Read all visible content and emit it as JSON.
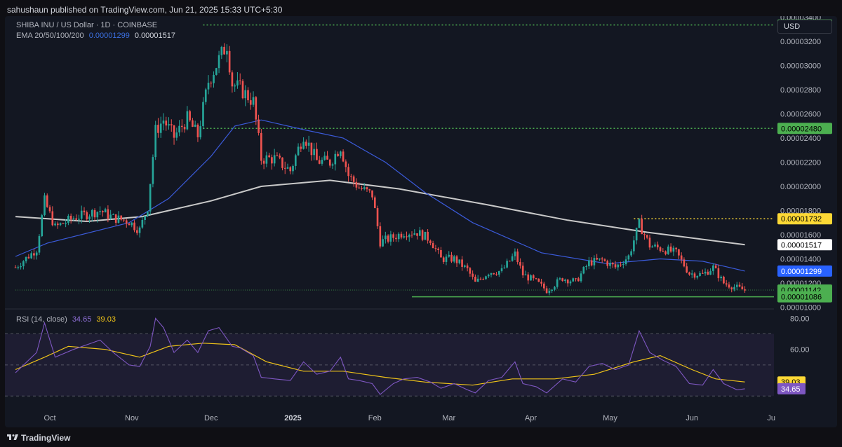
{
  "attribution": "sahushaun published on TradingView.com, Jun 21, 2025 15:33 UTC+5:30",
  "symbol_line": "SHIBA INU / US Dollar · 1D · COINBASE",
  "ema_legend": {
    "label": "EMA 20/50/100/200",
    "value1": "0.00001299",
    "value2": "0.00001517"
  },
  "rsi_legend": {
    "label": "RSI (14, close)",
    "value1": "34.65",
    "value2": "39.03"
  },
  "currency_button": "USD",
  "footer_brand": "TradingView",
  "colors": {
    "up": "#26a69a",
    "down": "#ef5350",
    "ema50": "#3b5bdb",
    "ema200": "#c9c9c9",
    "rsi": "#7e57c2",
    "rsi_ma": "#f0c419",
    "green_level": "#4caf50",
    "yellow_level": "#fdd835"
  },
  "chart_data": [
    {
      "type": "candlestick",
      "title": "SHIBA INU / US Dollar · 1D · COINBASE",
      "x_ticks": [
        "Oct",
        "Nov",
        "Dec",
        "2025",
        "Feb",
        "Mar",
        "Apr",
        "May",
        "Jun",
        "Ju"
      ],
      "y_ticks": [
        "0.00003400",
        "0.00003200",
        "0.00003000",
        "0.00002800",
        "0.00002600",
        "0.00002400",
        "0.00002200",
        "0.00002000",
        "0.00001800",
        "0.00001600",
        "0.00001400",
        "0.00001200",
        "0.00001000"
      ],
      "ylim": [
        9.85e-06,
        3.41e-05
      ],
      "price_labels": [
        {
          "text": "0.00003337",
          "value": 3.337e-05,
          "kind": "green"
        },
        {
          "text": "0.00002480",
          "value": 2.48e-05,
          "kind": "green"
        },
        {
          "text": "0.00001732",
          "value": 1.732e-05,
          "kind": "yellow"
        },
        {
          "text": "0.00001517",
          "value": 1.517e-05,
          "kind": "white"
        },
        {
          "text": "0.00001299",
          "value": 1.299e-05,
          "kind": "blue"
        },
        {
          "text": "0.00001142",
          "value": 1.142e-05,
          "kind": "green"
        },
        {
          "text": "0.00001086",
          "value": 1.086e-05,
          "kind": "green"
        }
      ],
      "levels": [
        {
          "value": 3.337e-05,
          "from": "2024-11-28",
          "style": "dotted-green"
        },
        {
          "value": 2.48e-05,
          "from": "2024-11-28",
          "style": "dotted-green"
        },
        {
          "value": 1.732e-05,
          "from": "2025-05-10",
          "style": "dotted-yellow"
        },
        {
          "value": 1.142e-05,
          "from": "2024-09-18",
          "style": "dotted-green-thin"
        },
        {
          "value": 1.086e-05,
          "from": "2025-02-15",
          "style": "solid-green"
        }
      ],
      "close_path": [
        [
          "2024-09-18",
          1.33e-05
        ],
        [
          "2024-09-26",
          1.48e-05
        ],
        [
          "2024-09-29",
          1.88e-05
        ],
        [
          "2024-10-03",
          1.66e-05
        ],
        [
          "2024-10-10",
          1.74e-05
        ],
        [
          "2024-10-20",
          1.8e-05
        ],
        [
          "2024-10-25",
          1.74e-05
        ],
        [
          "2024-10-31",
          1.71e-05
        ],
        [
          "2024-11-02",
          1.67e-05
        ],
        [
          "2024-11-04",
          1.64e-05
        ],
        [
          "2024-11-07",
          1.83e-05
        ],
        [
          "2024-11-10",
          2.46e-05
        ],
        [
          "2024-11-13",
          2.55e-05
        ],
        [
          "2024-11-17",
          2.41e-05
        ],
        [
          "2024-11-22",
          2.56e-05
        ],
        [
          "2024-11-26",
          2.42e-05
        ],
        [
          "2024-11-30",
          2.87e-05
        ],
        [
          "2024-12-04",
          3.05e-05
        ],
        [
          "2024-12-07",
          3.18e-05
        ],
        [
          "2024-12-09",
          2.85e-05
        ],
        [
          "2024-12-12",
          2.81e-05
        ],
        [
          "2024-12-17",
          2.7e-05
        ],
        [
          "2024-12-20",
          2.23e-05
        ],
        [
          "2024-12-25",
          2.23e-05
        ],
        [
          "2024-12-31",
          2.13e-05
        ],
        [
          "2025-01-05",
          2.43e-05
        ],
        [
          "2025-01-10",
          2.21e-05
        ],
        [
          "2025-01-15",
          2.2e-05
        ],
        [
          "2025-01-19",
          2.33e-05
        ],
        [
          "2025-01-22",
          2.09e-05
        ],
        [
          "2025-01-26",
          1.99e-05
        ],
        [
          "2025-01-31",
          1.93e-05
        ],
        [
          "2025-02-03",
          1.54e-05
        ],
        [
          "2025-02-08",
          1.58e-05
        ],
        [
          "2025-02-12",
          1.62e-05
        ],
        [
          "2025-02-17",
          1.62e-05
        ],
        [
          "2025-02-22",
          1.56e-05
        ],
        [
          "2025-02-26",
          1.4e-05
        ],
        [
          "2025-03-03",
          1.4e-05
        ],
        [
          "2025-03-08",
          1.31e-05
        ],
        [
          "2025-03-11",
          1.2e-05
        ],
        [
          "2025-03-16",
          1.29e-05
        ],
        [
          "2025-03-21",
          1.3e-05
        ],
        [
          "2025-03-26",
          1.44e-05
        ],
        [
          "2025-03-29",
          1.27e-05
        ],
        [
          "2025-04-03",
          1.21e-05
        ],
        [
          "2025-04-07",
          1.14e-05
        ],
        [
          "2025-04-13",
          1.24e-05
        ],
        [
          "2025-04-18",
          1.21e-05
        ],
        [
          "2025-04-23",
          1.37e-05
        ],
        [
          "2025-04-28",
          1.39e-05
        ],
        [
          "2025-05-03",
          1.33e-05
        ],
        [
          "2025-05-08",
          1.42e-05
        ],
        [
          "2025-05-12",
          1.69e-05
        ],
        [
          "2025-05-16",
          1.51e-05
        ],
        [
          "2025-05-21",
          1.48e-05
        ],
        [
          "2025-05-26",
          1.45e-05
        ],
        [
          "2025-05-31",
          1.28e-05
        ],
        [
          "2025-06-05",
          1.27e-05
        ],
        [
          "2025-06-09",
          1.33e-05
        ],
        [
          "2025-06-13",
          1.2e-05
        ],
        [
          "2025-06-18",
          1.16e-05
        ],
        [
          "2025-06-21",
          1.14e-05
        ]
      ],
      "ema50": [
        [
          "2024-09-18",
          1.42e-05
        ],
        [
          "2024-09-30",
          1.53e-05
        ],
        [
          "2024-10-31",
          1.7e-05
        ],
        [
          "2024-11-15",
          1.9e-05
        ],
        [
          "2024-12-01",
          2.25e-05
        ],
        [
          "2024-12-10",
          2.5e-05
        ],
        [
          "2024-12-20",
          2.55e-05
        ],
        [
          "2025-01-05",
          2.47e-05
        ],
        [
          "2025-01-20",
          2.4e-05
        ],
        [
          "2025-02-05",
          2.2e-05
        ],
        [
          "2025-02-20",
          1.95e-05
        ],
        [
          "2025-03-10",
          1.7e-05
        ],
        [
          "2025-04-05",
          1.45e-05
        ],
        [
          "2025-04-30",
          1.36e-05
        ],
        [
          "2025-05-20",
          1.4e-05
        ],
        [
          "2025-06-05",
          1.38e-05
        ],
        [
          "2025-06-21",
          1.299e-05
        ]
      ],
      "ema200": [
        [
          "2024-09-18",
          1.75e-05
        ],
        [
          "2024-10-15",
          1.71e-05
        ],
        [
          "2024-11-05",
          1.75e-05
        ],
        [
          "2024-12-01",
          1.88e-05
        ],
        [
          "2024-12-20",
          2e-05
        ],
        [
          "2025-01-15",
          2.05e-05
        ],
        [
          "2025-02-10",
          1.98e-05
        ],
        [
          "2025-03-15",
          1.85e-05
        ],
        [
          "2025-04-15",
          1.72e-05
        ],
        [
          "2025-05-15",
          1.62e-05
        ],
        [
          "2025-06-21",
          1.517e-05
        ]
      ]
    },
    {
      "type": "line",
      "title": "RSI (14, close)",
      "y_ticks": [
        "80.00",
        "60.00"
      ],
      "ylim": [
        22,
        86
      ],
      "guides": [
        70,
        50,
        30
      ],
      "value_labels": [
        {
          "text": "39.03",
          "value": 39.03,
          "kind": "yellow"
        },
        {
          "text": "34.65",
          "value": 34.65,
          "kind": "purple"
        }
      ],
      "series": [
        {
          "name": "RSI",
          "values": [
            [
              "2024-09-18",
              45
            ],
            [
              "2024-09-26",
              58
            ],
            [
              "2024-09-29",
              77
            ],
            [
              "2024-10-03",
              55
            ],
            [
              "2024-10-10",
              60
            ],
            [
              "2024-10-20",
              66
            ],
            [
              "2024-10-25",
              58
            ],
            [
              "2024-10-31",
              50
            ],
            [
              "2024-11-04",
              49
            ],
            [
              "2024-11-08",
              62
            ],
            [
              "2024-11-10",
              80
            ],
            [
              "2024-11-13",
              74
            ],
            [
              "2024-11-17",
              58
            ],
            [
              "2024-11-22",
              66
            ],
            [
              "2024-11-26",
              58
            ],
            [
              "2024-11-30",
              72
            ],
            [
              "2024-12-04",
              74
            ],
            [
              "2024-12-09",
              62
            ],
            [
              "2024-12-12",
              61
            ],
            [
              "2024-12-17",
              56
            ],
            [
              "2024-12-20",
              42
            ],
            [
              "2024-12-25",
              41
            ],
            [
              "2024-12-31",
              40
            ],
            [
              "2025-01-05",
              52
            ],
            [
              "2025-01-10",
              44
            ],
            [
              "2025-01-15",
              46
            ],
            [
              "2025-01-19",
              55
            ],
            [
              "2025-01-22",
              41
            ],
            [
              "2025-01-26",
              40
            ],
            [
              "2025-01-31",
              38
            ],
            [
              "2025-02-03",
              31
            ],
            [
              "2025-02-08",
              38
            ],
            [
              "2025-02-12",
              41
            ],
            [
              "2025-02-17",
              42
            ],
            [
              "2025-02-22",
              39
            ],
            [
              "2025-02-26",
              35
            ],
            [
              "2025-03-03",
              38
            ],
            [
              "2025-03-08",
              34
            ],
            [
              "2025-03-11",
              32
            ],
            [
              "2025-03-16",
              40
            ],
            [
              "2025-03-21",
              42
            ],
            [
              "2025-03-26",
              52
            ],
            [
              "2025-03-29",
              38
            ],
            [
              "2025-04-03",
              36
            ],
            [
              "2025-04-07",
              32
            ],
            [
              "2025-04-13",
              41
            ],
            [
              "2025-04-18",
              39
            ],
            [
              "2025-04-23",
              49
            ],
            [
              "2025-04-28",
              51
            ],
            [
              "2025-05-03",
              47
            ],
            [
              "2025-05-08",
              50
            ],
            [
              "2025-05-12",
              72
            ],
            [
              "2025-05-16",
              58
            ],
            [
              "2025-05-21",
              53
            ],
            [
              "2025-05-26",
              49
            ],
            [
              "2025-05-31",
              38
            ],
            [
              "2025-06-05",
              37
            ],
            [
              "2025-06-09",
              47
            ],
            [
              "2025-06-13",
              38
            ],
            [
              "2025-06-18",
              34
            ],
            [
              "2025-06-21",
              34.65
            ]
          ]
        },
        {
          "name": "RSI-based MA",
          "values": [
            [
              "2024-09-18",
              47
            ],
            [
              "2024-09-29",
              55
            ],
            [
              "2024-10-08",
              62
            ],
            [
              "2024-10-22",
              60
            ],
            [
              "2024-11-04",
              55
            ],
            [
              "2024-11-15",
              62
            ],
            [
              "2024-11-28",
              64
            ],
            [
              "2024-12-10",
              63
            ],
            [
              "2024-12-22",
              52
            ],
            [
              "2025-01-05",
              46
            ],
            [
              "2025-01-20",
              46
            ],
            [
              "2025-02-05",
              42
            ],
            [
              "2025-02-20",
              39
            ],
            [
              "2025-03-10",
              37
            ],
            [
              "2025-03-25",
              41
            ],
            [
              "2025-04-10",
              41
            ],
            [
              "2025-04-25",
              44
            ],
            [
              "2025-05-10",
              52
            ],
            [
              "2025-05-20",
              56
            ],
            [
              "2025-06-01",
              47
            ],
            [
              "2025-06-10",
              41
            ],
            [
              "2025-06-21",
              39.03
            ]
          ]
        }
      ]
    }
  ]
}
